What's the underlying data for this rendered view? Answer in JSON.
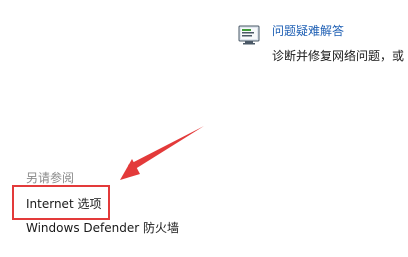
{
  "task": {
    "icon": "troubleshoot-monitor-icon",
    "title": "问题疑难解答",
    "description": "诊断并修复网络问题，或"
  },
  "see_also": {
    "heading": "另请参阅",
    "links": [
      {
        "label": "Internet 选项"
      },
      {
        "label": "Windows Defender 防火墙"
      }
    ]
  },
  "annotation": {
    "color": "#e33a3a"
  }
}
